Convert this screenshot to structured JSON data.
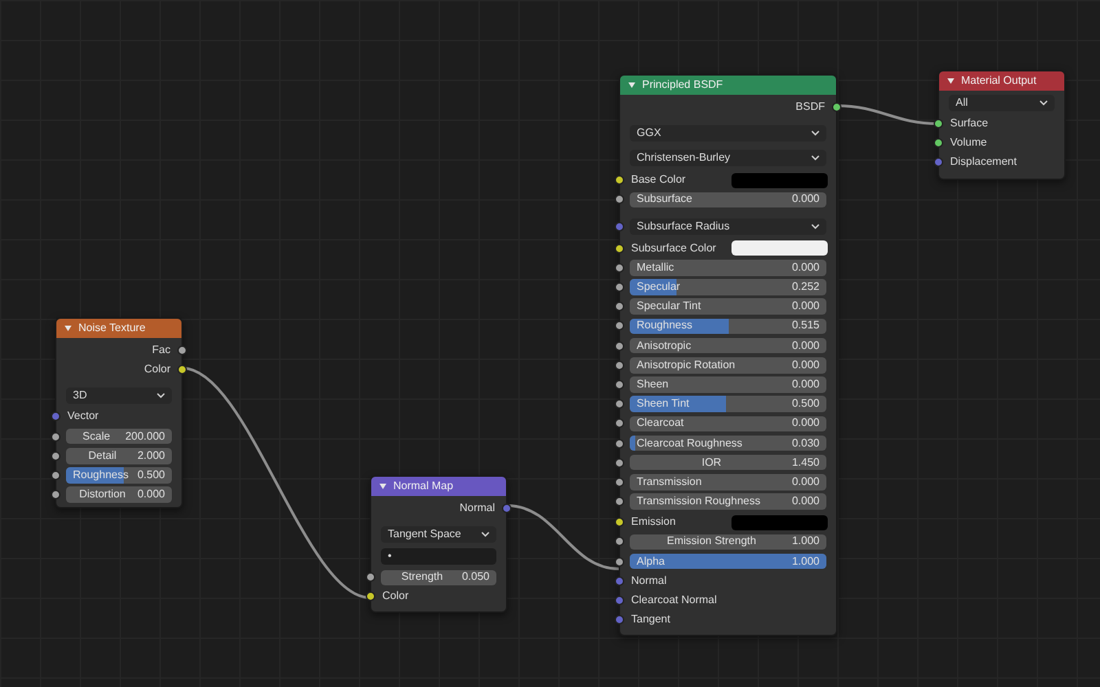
{
  "nodes": [
    {
      "title": "Noise Texture",
      "color": "#b45c2a",
      "rows": [
        {
          "kind": "output",
          "label": "Fac",
          "socket": {
            "kind": "float"
          }
        },
        {
          "kind": "output",
          "label": "Color",
          "socket": {
            "kind": "color"
          }
        },
        {
          "kind": "dropdown",
          "value": "3D"
        },
        {
          "kind": "input",
          "label": "Vector",
          "socket": {
            "kind": "vector"
          }
        },
        {
          "kind": "number",
          "label": "Scale",
          "value": "200.000",
          "socket": {
            "kind": "float"
          }
        },
        {
          "kind": "number",
          "label": "Detail",
          "value": "2.000",
          "socket": {
            "kind": "float"
          }
        },
        {
          "kind": "slider",
          "label": "Roughness",
          "value": "0.500",
          "level": 0.55,
          "socket": {
            "kind": "float"
          }
        },
        {
          "kind": "number",
          "label": "Distortion",
          "value": "0.000",
          "socket": {
            "kind": "float"
          }
        }
      ]
    },
    {
      "title": "Normal Map",
      "color": "#6857c0",
      "rows": [
        {
          "kind": "output",
          "label": "Normal",
          "socket": {
            "kind": "vector"
          }
        },
        {
          "kind": "dropdown",
          "value": "Tangent Space"
        },
        {
          "kind": "field",
          "value": "•"
        },
        {
          "kind": "number",
          "label": "Strength",
          "value": "0.050",
          "socket": {
            "kind": "float"
          }
        },
        {
          "kind": "input",
          "label": "Color",
          "socket": {
            "kind": "color"
          }
        }
      ]
    },
    {
      "title": "Principled BSDF",
      "color": "#2d8a58",
      "rows": [
        {
          "kind": "output",
          "label": "BSDF",
          "socket": {
            "kind": "shader"
          }
        },
        {
          "kind": "dropdown",
          "value": "GGX"
        },
        {
          "kind": "dropdown",
          "value": "Christensen-Burley"
        },
        {
          "kind": "color",
          "label": "Base Color",
          "color": "#000000",
          "socket": {
            "kind": "color"
          }
        },
        {
          "kind": "slider",
          "label": "Subsurface",
          "value": "0.000",
          "level": 0,
          "socket": {
            "kind": "float"
          }
        },
        {
          "kind": "dropdown",
          "value": "Subsurface Radius",
          "socket": {
            "kind": "vector"
          }
        },
        {
          "kind": "color",
          "label": "Subsurface Color",
          "color": "#f0f0f0",
          "socket": {
            "kind": "color"
          }
        },
        {
          "kind": "slider",
          "label": "Metallic",
          "value": "0.000",
          "level": 0,
          "socket": {
            "kind": "float"
          }
        },
        {
          "kind": "slider",
          "label": "Specular",
          "value": "0.252",
          "level": 0.24,
          "socket": {
            "kind": "float"
          }
        },
        {
          "kind": "slider",
          "label": "Specular Tint",
          "value": "0.000",
          "level": 0,
          "socket": {
            "kind": "float"
          }
        },
        {
          "kind": "slider",
          "label": "Roughness",
          "value": "0.515",
          "level": 0.5,
          "socket": {
            "kind": "float"
          }
        },
        {
          "kind": "slider",
          "label": "Anisotropic",
          "value": "0.000",
          "level": 0,
          "socket": {
            "kind": "float"
          }
        },
        {
          "kind": "slider",
          "label": "Anisotropic Rotation",
          "value": "0.000",
          "level": 0,
          "socket": {
            "kind": "float"
          }
        },
        {
          "kind": "slider",
          "label": "Sheen",
          "value": "0.000",
          "level": 0,
          "socket": {
            "kind": "float"
          }
        },
        {
          "kind": "slider",
          "label": "Sheen Tint",
          "value": "0.500",
          "level": 0.49,
          "socket": {
            "kind": "float"
          }
        },
        {
          "kind": "slider",
          "label": "Clearcoat",
          "value": "0.000",
          "level": 0,
          "socket": {
            "kind": "float"
          }
        },
        {
          "kind": "slider",
          "label": "Clearcoat Roughness",
          "value": "0.030",
          "level": 0.03,
          "socket": {
            "kind": "float"
          }
        },
        {
          "kind": "number",
          "label": "IOR",
          "value": "1.450",
          "socket": {
            "kind": "float"
          }
        },
        {
          "kind": "slider",
          "label": "Transmission",
          "value": "0.000",
          "level": 0,
          "socket": {
            "kind": "float"
          }
        },
        {
          "kind": "slider",
          "label": "Transmission Roughness",
          "value": "0.000",
          "level": 0,
          "socket": {
            "kind": "float"
          }
        },
        {
          "kind": "color",
          "label": "Emission",
          "color": "#000000",
          "socket": {
            "kind": "color"
          }
        },
        {
          "kind": "number",
          "label": "Emission Strength",
          "value": "1.000",
          "socket": {
            "kind": "float"
          }
        },
        {
          "kind": "slider",
          "label": "Alpha",
          "value": "1.000",
          "level": 1,
          "socket": {
            "kind": "float"
          }
        },
        {
          "kind": "input",
          "label": "Normal",
          "socket": {
            "kind": "vector"
          }
        },
        {
          "kind": "input",
          "label": "Clearcoat Normal",
          "socket": {
            "kind": "vector"
          }
        },
        {
          "kind": "input",
          "label": "Tangent",
          "socket": {
            "kind": "vector"
          }
        }
      ]
    },
    {
      "title": "Material Output",
      "color": "#a8323a",
      "rows": [
        {
          "kind": "dropdown",
          "value": "All"
        },
        {
          "kind": "input",
          "label": "Surface",
          "socket": {
            "kind": "shader"
          }
        },
        {
          "kind": "input",
          "label": "Volume",
          "socket": {
            "kind": "shader"
          }
        },
        {
          "kind": "input",
          "label": "Displacement",
          "socket": {
            "kind": "vector"
          }
        }
      ]
    }
  ]
}
